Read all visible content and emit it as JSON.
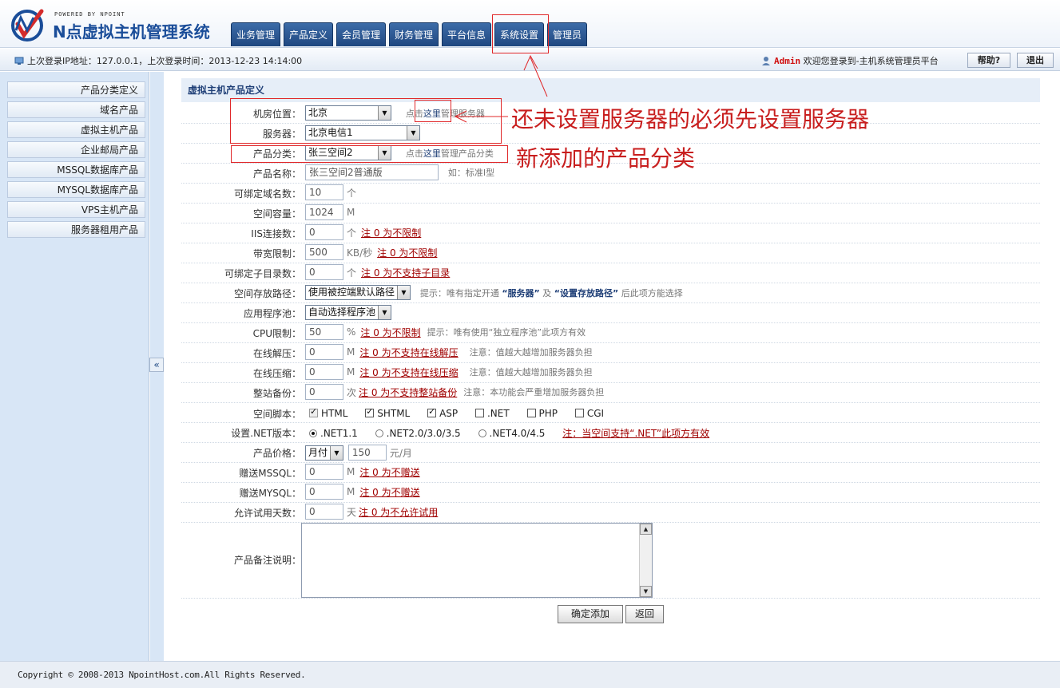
{
  "header": {
    "powered_by": "POWERED BY NPOINT",
    "brand": "N点虚拟主机管理系统",
    "nav_tabs": [
      "业务管理",
      "产品定义",
      "会员管理",
      "财务管理",
      "平台信息",
      "系统设置",
      "管理员"
    ]
  },
  "infobar": {
    "login_info": "上次登录IP地址：127.0.0.1，上次登录时间：2013-12-23 14:14:00",
    "admin_name": "Admin",
    "welcome": "欢迎您登录到-主机系统管理员平台",
    "help_label": "帮助?",
    "logout_label": "退出"
  },
  "sidebar": {
    "items": [
      "产品分类定义",
      "域名产品",
      "虚拟主机产品",
      "企业邮局产品",
      "MSSQL数据库产品",
      "MYSQL数据库产品",
      "VPS主机产品",
      "服务器租用产品"
    ],
    "collapse": "«"
  },
  "form": {
    "section_title": "虚拟主机产品定义",
    "datacenter_label": "机房位置：",
    "datacenter_value": "北京",
    "datacenter_hint_pre": "点击",
    "datacenter_hint_link": "这里",
    "datacenter_hint_post": "管理服务器",
    "server_label": "服务器：",
    "server_value": "北京电信1",
    "category_label": "产品分类：",
    "category_value": "张三空间2",
    "category_hint_pre": "点击",
    "category_hint_link": "这里",
    "category_hint_post": "管理产品分类",
    "name_label": "产品名称：",
    "name_value": "张三空间2普通版",
    "name_hint": "如：标准I型",
    "domains_label": "可绑定域名数：",
    "domains_value": "10",
    "domains_unit": "个",
    "space_label": "空间容量：",
    "space_value": "1024",
    "space_unit": "M",
    "iis_label": "IIS连接数：",
    "iis_value": "0",
    "iis_unit": "个",
    "iis_note": "注 0 为不限制",
    "bandwidth_label": "带宽限制：",
    "bandwidth_value": "500",
    "bandwidth_unit": "KB/秒",
    "bandwidth_note": "注 0 为不限制",
    "subdir_label": "可绑定子目录数：",
    "subdir_value": "0",
    "subdir_unit": "个",
    "subdir_note": "注 0 为不支持子目录",
    "path_label": "空间存放路径：",
    "path_value": "使用被控端默认路径",
    "path_hint_1": "提示：唯有指定开通",
    "path_hint_b1": "“服务器”",
    "path_hint_2": "及",
    "path_hint_b2": "“设置存放路径”",
    "path_hint_3": "后此项方能选择",
    "pool_label": "应用程序池：",
    "pool_value": "自动选择程序池",
    "cpu_label": "CPU限制：",
    "cpu_value": "50",
    "cpu_unit": "%",
    "cpu_note": "注 0 为不限制",
    "cpu_hint": "提示：唯有使用“独立程序池”此项方有效",
    "unzip_label": "在线解压：",
    "unzip_value": "0",
    "unzip_unit": "M",
    "unzip_note": "注 0 为不支持在线解压",
    "unzip_hint": "注意：值越大越增加服务器负担",
    "zip_label": "在线压缩：",
    "zip_value": "0",
    "zip_unit": "M",
    "zip_note": "注 0 为不支持在线压缩",
    "zip_hint": "注意：值越大越增加服务器负担",
    "backup_label": "整站备份：",
    "backup_value": "0",
    "backup_unit": "次",
    "backup_note": "注 0 为不支持整站备份",
    "backup_hint": "注意：本功能会严重增加服务器负担",
    "script_label": "空间脚本：",
    "scripts": [
      "HTML",
      "SHTML",
      "ASP",
      ".NET",
      "PHP",
      "CGI"
    ],
    "net_label": "设置.NET版本：",
    "net_options": [
      ".NET1.1",
      ".NET2.0/3.0/3.5",
      ".NET4.0/4.5"
    ],
    "net_note": "注：当空间支持“.NET”此项方有效",
    "price_label": "产品价格：",
    "price_period": "月付",
    "price_value": "150",
    "price_unit": "元/月",
    "mssql_label": "赠送MSSQL：",
    "mssql_value": "0",
    "mssql_unit": "M",
    "mssql_note": "注 0 为不赠送",
    "mysql_label": "赠送MYSQL：",
    "mysql_value": "0",
    "mysql_unit": "M",
    "mysql_note": "注 0 为不赠送",
    "trial_label": "允许试用天数：",
    "trial_value": "0",
    "trial_unit": "天",
    "trial_note": "注 0 为不允许试用",
    "remark_label": "产品备注说明：",
    "submit_label": "确定添加",
    "back_label": "返回"
  },
  "annotations": {
    "server_note": "还未设置服务器的必须先设置服务器",
    "category_note": "新添加的产品分类"
  },
  "footer": {
    "copyright": "Copyright © 2008-2013 NpointHost.com.All Rights Reserved."
  },
  "colors": {
    "nav_tab": "#2b5a96",
    "annotation": "#e0282a",
    "note": "#a00000"
  }
}
